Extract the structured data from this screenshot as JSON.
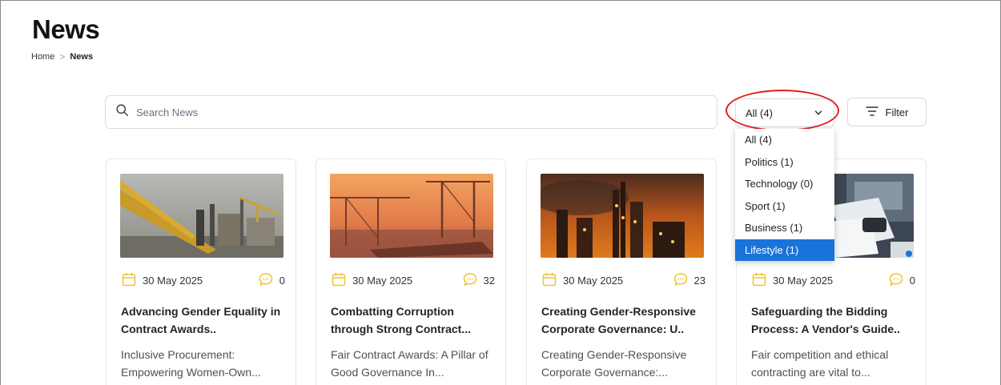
{
  "header": {
    "title": "News",
    "breadcrumb": {
      "home": "Home",
      "separator": ">",
      "current": "News"
    }
  },
  "toolbar": {
    "search_placeholder": "Search News",
    "category_value": "All (4)",
    "filter_label": "Filter"
  },
  "dropdown": {
    "options": [
      "All (4)",
      "Politics (1)",
      "Technology (0)",
      "Sport (1)",
      "Business (1)",
      "Lifestyle (1)"
    ],
    "highlighted": "Lifestyle (1)"
  },
  "colors": {
    "accent": "#1a73d9",
    "icon_yellow": "#f2c12e",
    "annotation": "#e02020"
  },
  "cards": [
    {
      "date": "30 May 2025",
      "comments": "0",
      "title": "Advancing Gender Equality in Contract Awards..",
      "excerpt": "Inclusive Procurement: Empowering Women-Own...",
      "image": "offshore-rig-image"
    },
    {
      "date": "30 May 2025",
      "comments": "32",
      "title": "Combatting Corruption through Strong Contract...",
      "excerpt": "Fair Contract Awards: A Pillar of Good Governance In...",
      "image": "port-cranes-image"
    },
    {
      "date": "30 May 2025",
      "comments": "23",
      "title": "Creating Gender-Responsive Corporate Governance: U..",
      "excerpt": "Creating Gender-Responsive Corporate Governance:...",
      "image": "refinery-night-image"
    },
    {
      "date": "30 May 2025",
      "comments": "0",
      "title": "Safeguarding the Bidding Process: A Vendor's Guide..",
      "excerpt": "Fair competition and ethical contracting are vital to...",
      "image": "office-documents-image"
    }
  ]
}
